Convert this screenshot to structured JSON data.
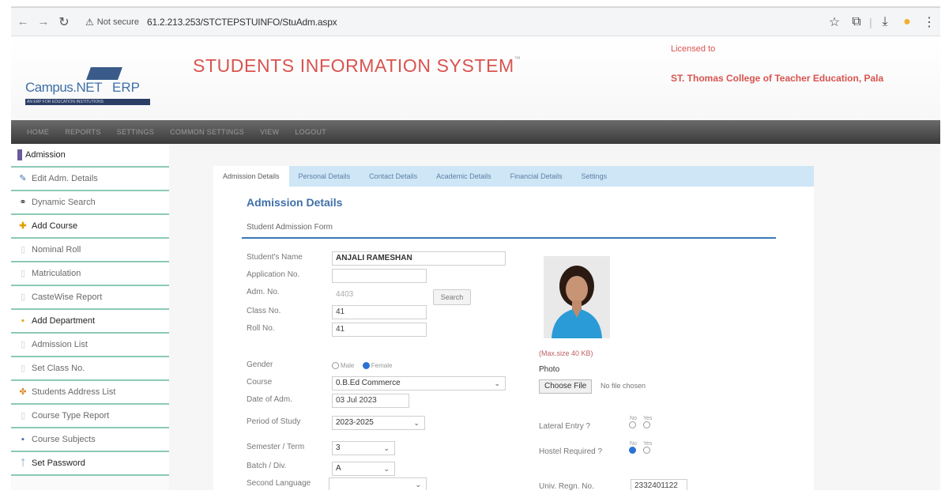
{
  "browser": {
    "security_label": "Not secure",
    "url": "61.2.213.253/STCTEPSTUINFO/StuAdm.aspx"
  },
  "header": {
    "logo_text_1": "Campus.NET",
    "logo_text_2": "ERP",
    "logo_tagline": "AN ERP FOR EDUCATION INSTITUTIONS",
    "title": "STUDENTS INFORMATION SYSTEM",
    "title_mark": "™",
    "licensed_label": "Licensed to",
    "licensee": "ST. Thomas College of Teacher Education, Pala"
  },
  "menu": {
    "items": [
      "Home",
      "Reports",
      "Settings",
      "Common Settings",
      "View",
      "Logout"
    ]
  },
  "sidebar": {
    "items": [
      {
        "label": "Admission",
        "icon": "admission-icon"
      },
      {
        "label": "Edit Adm. Details",
        "icon": "pencil-icon"
      },
      {
        "label": "Dynamic Search",
        "icon": "binoculars-icon"
      },
      {
        "label": "Add Course",
        "icon": "plus-icon"
      },
      {
        "label": "Nominal Roll",
        "icon": "doc-icon"
      },
      {
        "label": "Matriculation",
        "icon": "doc-icon"
      },
      {
        "label": "CasteWise Report",
        "icon": "doc-icon"
      },
      {
        "label": "Add Department",
        "icon": "plus-icon"
      },
      {
        "label": "Admission List",
        "icon": "doc-icon"
      },
      {
        "label": "Set Class No.",
        "icon": "doc-icon"
      },
      {
        "label": "Students Address List",
        "icon": "tree-icon"
      },
      {
        "label": "Course Type Report",
        "icon": "doc-icon"
      },
      {
        "label": "Course Subjects",
        "icon": "list-icon"
      },
      {
        "label": "Set Password",
        "icon": "key-icon"
      }
    ]
  },
  "tabs": [
    "Admission Details",
    "Personal Details",
    "Contact Details",
    "Academic Details",
    "Financial Details",
    "Settings"
  ],
  "section_title": "Admission Details",
  "form_title": "Student Admission Form",
  "form": {
    "student_name_label": "Student's Name",
    "student_name_value": "ANJALI RAMESHAN",
    "application_no_label": "Application No.",
    "application_no_value": "",
    "adm_no_label": "Adm. No.",
    "adm_no_value": "4403",
    "search_button": "Search",
    "class_no_label": "Class No.",
    "class_no_value": "41",
    "roll_no_label": "Roll No.",
    "roll_no_value": "41",
    "gender_label": "Gender",
    "gender_male": "Male",
    "gender_female": "Female",
    "course_label": "Course",
    "course_value": "0.B.Ed Commerce",
    "date_of_adm_label": "Date of Adm.",
    "date_of_adm_value": "03 Jul 2023",
    "period_label": "Period of Study",
    "period_value": "2023-2025",
    "semester_label": "Semester / Term",
    "semester_value": "3",
    "batch_label": "Batch / Div.",
    "batch_value": "A",
    "second_lang_label": "Second Language",
    "second_lang_value": "",
    "photo_max": "(Max.size 40 KB)",
    "photo_label": "Photo",
    "choose_file": "Choose File",
    "no_file": "No file chosen",
    "lateral_label": "Lateral Entry ?",
    "hostel_label": "Hostel Required ?",
    "no_text": "No",
    "yes_text": "Yes",
    "univ_regn_label": "Univ. Regn. No.",
    "univ_regn_value": "2332401122"
  },
  "colors": {
    "title_red": "#d9534f",
    "accent_blue": "#3f6fa8",
    "tab_bar": "#cfe6f6",
    "sidebar_divider": "#8cc9b8"
  }
}
